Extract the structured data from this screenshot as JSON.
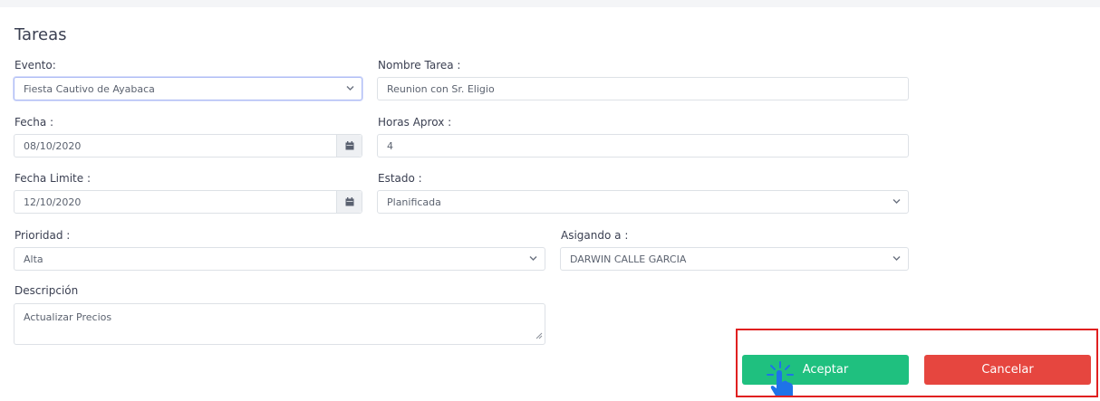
{
  "title": "Tareas",
  "fields": {
    "evento": {
      "label": "Evento:",
      "value": "Fiesta Cautivo de Ayabaca"
    },
    "nombre_tarea": {
      "label": "Nombre Tarea :",
      "value": "Reunion con Sr. Eligio"
    },
    "fecha": {
      "label": "Fecha :",
      "value": "08/10/2020"
    },
    "horas_aprox": {
      "label": "Horas Aprox :",
      "value": "4"
    },
    "fecha_limite": {
      "label": "Fecha Limite :",
      "value": "12/10/2020"
    },
    "estado": {
      "label": "Estado :",
      "value": "Planificada"
    },
    "prioridad": {
      "label": "Prioridad :",
      "value": "Alta"
    },
    "asignado": {
      "label": "Asigando a :",
      "value": "DARWIN CALLE GARCIA"
    },
    "descripcion": {
      "label": "Descripción",
      "value": "Actualizar Precios"
    }
  },
  "buttons": {
    "accept": "Aceptar",
    "cancel": "Cancelar"
  },
  "icons": {
    "calendar": "calendar-icon",
    "chevron": "chevron-down-icon",
    "pointer": "hand-pointer-icon"
  },
  "colors": {
    "accept": "#1fc07f",
    "cancel": "#e6463f",
    "highlight": "#e02020",
    "pointer": "#1e73e8"
  }
}
